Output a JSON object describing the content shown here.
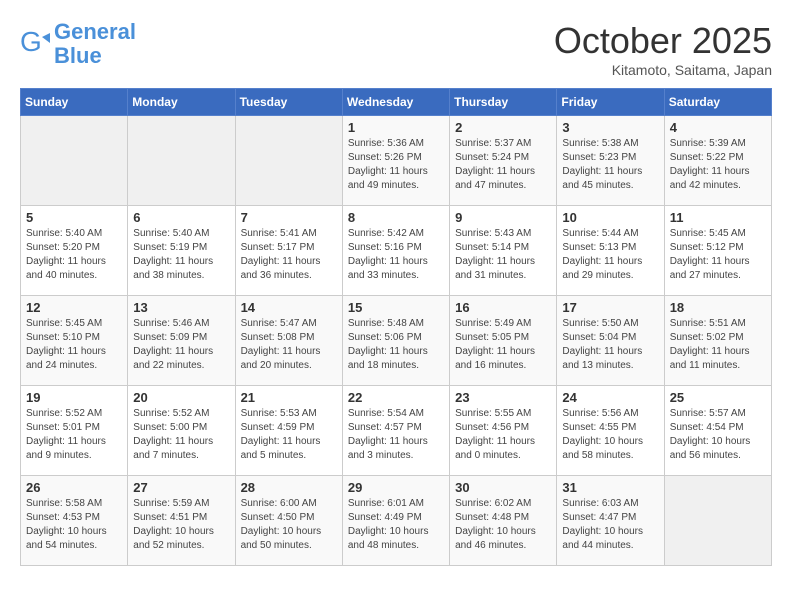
{
  "header": {
    "logo_line1": "General",
    "logo_line2": "Blue",
    "month": "October 2025",
    "location": "Kitamoto, Saitama, Japan"
  },
  "weekdays": [
    "Sunday",
    "Monday",
    "Tuesday",
    "Wednesday",
    "Thursday",
    "Friday",
    "Saturday"
  ],
  "weeks": [
    [
      {
        "day": "",
        "content": ""
      },
      {
        "day": "",
        "content": ""
      },
      {
        "day": "",
        "content": ""
      },
      {
        "day": "1",
        "content": "Sunrise: 5:36 AM\nSunset: 5:26 PM\nDaylight: 11 hours\nand 49 minutes."
      },
      {
        "day": "2",
        "content": "Sunrise: 5:37 AM\nSunset: 5:24 PM\nDaylight: 11 hours\nand 47 minutes."
      },
      {
        "day": "3",
        "content": "Sunrise: 5:38 AM\nSunset: 5:23 PM\nDaylight: 11 hours\nand 45 minutes."
      },
      {
        "day": "4",
        "content": "Sunrise: 5:39 AM\nSunset: 5:22 PM\nDaylight: 11 hours\nand 42 minutes."
      }
    ],
    [
      {
        "day": "5",
        "content": "Sunrise: 5:40 AM\nSunset: 5:20 PM\nDaylight: 11 hours\nand 40 minutes."
      },
      {
        "day": "6",
        "content": "Sunrise: 5:40 AM\nSunset: 5:19 PM\nDaylight: 11 hours\nand 38 minutes."
      },
      {
        "day": "7",
        "content": "Sunrise: 5:41 AM\nSunset: 5:17 PM\nDaylight: 11 hours\nand 36 minutes."
      },
      {
        "day": "8",
        "content": "Sunrise: 5:42 AM\nSunset: 5:16 PM\nDaylight: 11 hours\nand 33 minutes."
      },
      {
        "day": "9",
        "content": "Sunrise: 5:43 AM\nSunset: 5:14 PM\nDaylight: 11 hours\nand 31 minutes."
      },
      {
        "day": "10",
        "content": "Sunrise: 5:44 AM\nSunset: 5:13 PM\nDaylight: 11 hours\nand 29 minutes."
      },
      {
        "day": "11",
        "content": "Sunrise: 5:45 AM\nSunset: 5:12 PM\nDaylight: 11 hours\nand 27 minutes."
      }
    ],
    [
      {
        "day": "12",
        "content": "Sunrise: 5:45 AM\nSunset: 5:10 PM\nDaylight: 11 hours\nand 24 minutes."
      },
      {
        "day": "13",
        "content": "Sunrise: 5:46 AM\nSunset: 5:09 PM\nDaylight: 11 hours\nand 22 minutes."
      },
      {
        "day": "14",
        "content": "Sunrise: 5:47 AM\nSunset: 5:08 PM\nDaylight: 11 hours\nand 20 minutes."
      },
      {
        "day": "15",
        "content": "Sunrise: 5:48 AM\nSunset: 5:06 PM\nDaylight: 11 hours\nand 18 minutes."
      },
      {
        "day": "16",
        "content": "Sunrise: 5:49 AM\nSunset: 5:05 PM\nDaylight: 11 hours\nand 16 minutes."
      },
      {
        "day": "17",
        "content": "Sunrise: 5:50 AM\nSunset: 5:04 PM\nDaylight: 11 hours\nand 13 minutes."
      },
      {
        "day": "18",
        "content": "Sunrise: 5:51 AM\nSunset: 5:02 PM\nDaylight: 11 hours\nand 11 minutes."
      }
    ],
    [
      {
        "day": "19",
        "content": "Sunrise: 5:52 AM\nSunset: 5:01 PM\nDaylight: 11 hours\nand 9 minutes."
      },
      {
        "day": "20",
        "content": "Sunrise: 5:52 AM\nSunset: 5:00 PM\nDaylight: 11 hours\nand 7 minutes."
      },
      {
        "day": "21",
        "content": "Sunrise: 5:53 AM\nSunset: 4:59 PM\nDaylight: 11 hours\nand 5 minutes."
      },
      {
        "day": "22",
        "content": "Sunrise: 5:54 AM\nSunset: 4:57 PM\nDaylight: 11 hours\nand 3 minutes."
      },
      {
        "day": "23",
        "content": "Sunrise: 5:55 AM\nSunset: 4:56 PM\nDaylight: 11 hours\nand 0 minutes."
      },
      {
        "day": "24",
        "content": "Sunrise: 5:56 AM\nSunset: 4:55 PM\nDaylight: 10 hours\nand 58 minutes."
      },
      {
        "day": "25",
        "content": "Sunrise: 5:57 AM\nSunset: 4:54 PM\nDaylight: 10 hours\nand 56 minutes."
      }
    ],
    [
      {
        "day": "26",
        "content": "Sunrise: 5:58 AM\nSunset: 4:53 PM\nDaylight: 10 hours\nand 54 minutes."
      },
      {
        "day": "27",
        "content": "Sunrise: 5:59 AM\nSunset: 4:51 PM\nDaylight: 10 hours\nand 52 minutes."
      },
      {
        "day": "28",
        "content": "Sunrise: 6:00 AM\nSunset: 4:50 PM\nDaylight: 10 hours\nand 50 minutes."
      },
      {
        "day": "29",
        "content": "Sunrise: 6:01 AM\nSunset: 4:49 PM\nDaylight: 10 hours\nand 48 minutes."
      },
      {
        "day": "30",
        "content": "Sunrise: 6:02 AM\nSunset: 4:48 PM\nDaylight: 10 hours\nand 46 minutes."
      },
      {
        "day": "31",
        "content": "Sunrise: 6:03 AM\nSunset: 4:47 PM\nDaylight: 10 hours\nand 44 minutes."
      },
      {
        "day": "",
        "content": ""
      }
    ]
  ]
}
